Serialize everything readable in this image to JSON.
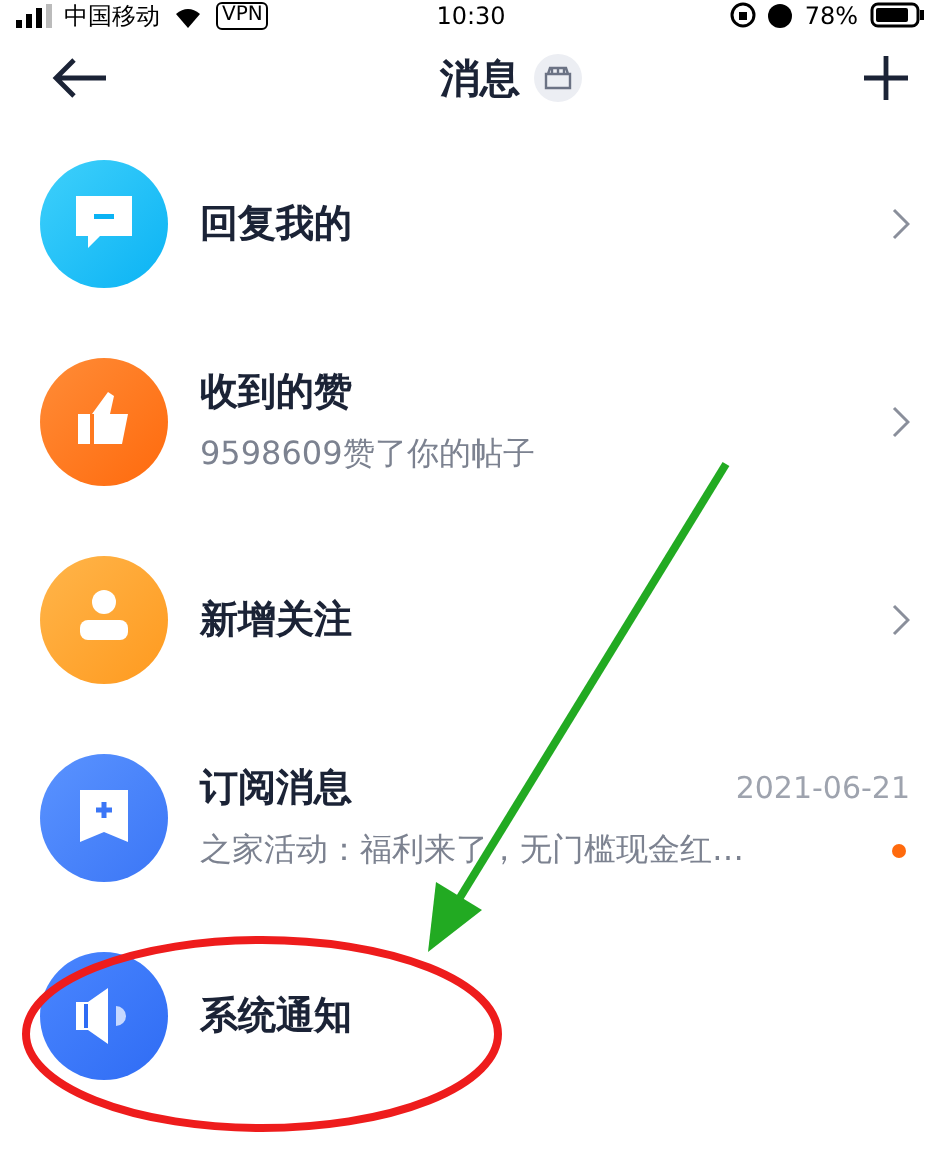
{
  "status_bar": {
    "carrier": "中国移动",
    "vpn": "VPN",
    "time": "10:30",
    "battery": "78%"
  },
  "nav": {
    "title": "消息"
  },
  "items": [
    {
      "kind": "reply",
      "title": "回复我的",
      "chevron": true,
      "unread": false
    },
    {
      "kind": "like",
      "title": "收到的赞",
      "subtitle": "9598609赞了你的帖子",
      "chevron": true,
      "unread": false
    },
    {
      "kind": "follow",
      "title": "新增关注",
      "chevron": true,
      "unread": false
    },
    {
      "kind": "subscribe",
      "title": "订阅消息",
      "subtitle": "之家活动：福利来了，无门槛现金红…",
      "date": "2021-06-21",
      "chevron": false,
      "unread": true
    },
    {
      "kind": "notice",
      "title": "系统通知",
      "chevron": false,
      "unread": false
    }
  ]
}
